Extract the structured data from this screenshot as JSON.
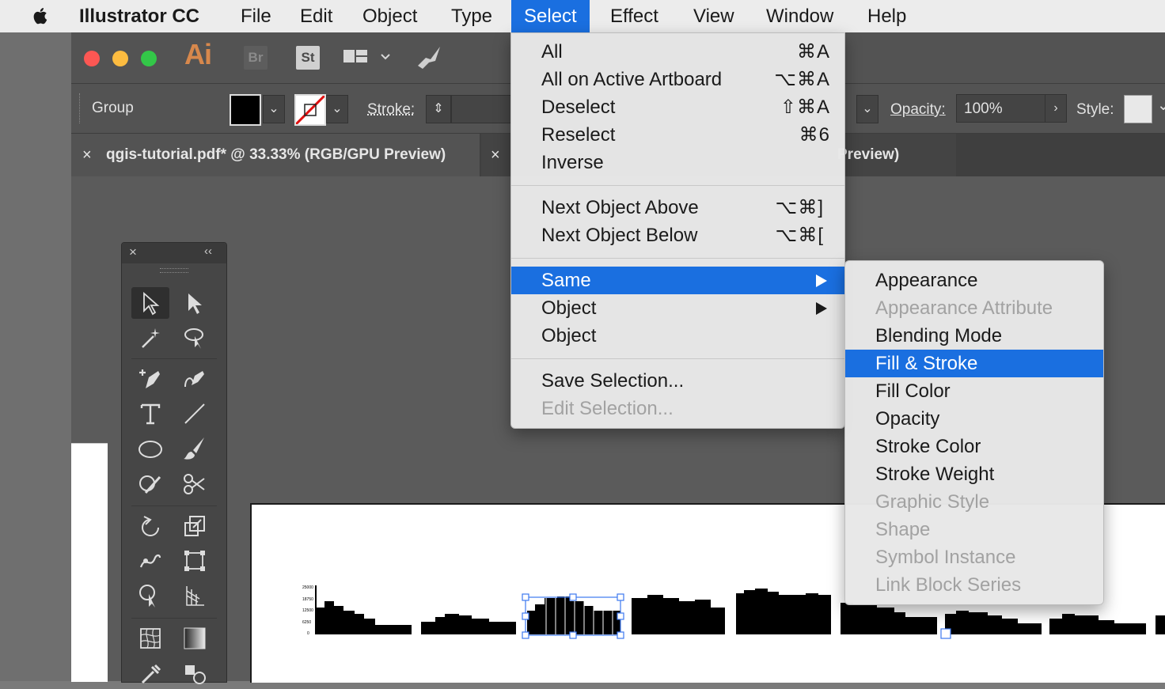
{
  "menubar": {
    "app_name": "Illustrator CC",
    "items": [
      "File",
      "Edit",
      "Object",
      "Type",
      "Select",
      "Effect",
      "View",
      "Window",
      "Help"
    ],
    "active": "Select"
  },
  "app": {
    "logo": "Ai",
    "bridge_label": "Br",
    "stock_label": "St",
    "traffic_colors": [
      "#fc5753",
      "#fdbc40",
      "#33c748"
    ]
  },
  "control_bar": {
    "selection_type": "Group",
    "stroke_label": "Stroke:",
    "opacity_label": "Opacity:",
    "opacity_value": "100%",
    "style_label": "Style:"
  },
  "tabs": [
    {
      "label": "qgis-tutorial.pdf* @ 33.33% (RGB/GPU Preview)"
    },
    {
      "label": "Preview)"
    }
  ],
  "select_menu": {
    "items": [
      {
        "label": "All",
        "shortcut": "⌘A",
        "state": "normal"
      },
      {
        "label": "All on Active Artboard",
        "shortcut": "⌥⌘A",
        "state": "normal"
      },
      {
        "label": "Deselect",
        "shortcut": "⇧⌘A",
        "state": "normal"
      },
      {
        "label": "Reselect",
        "shortcut": "⌘6",
        "state": "normal"
      },
      {
        "label": "Inverse",
        "shortcut": "",
        "state": "normal"
      },
      {
        "label": "Next Object Above",
        "shortcut": "⌥⌘]",
        "state": "normal"
      },
      {
        "label": "Next Object Below",
        "shortcut": "⌥⌘[",
        "state": "normal"
      },
      {
        "label": "Same",
        "shortcut": "",
        "state": "highlighted",
        "submenu": true
      },
      {
        "label": "Object",
        "shortcut": "",
        "state": "normal",
        "submenu": true
      },
      {
        "label": "Object",
        "shortcut": "",
        "state": "normal"
      },
      {
        "label": "Save Selection...",
        "shortcut": "",
        "state": "normal"
      },
      {
        "label": "Edit Selection...",
        "shortcut": "",
        "state": "disabled"
      }
    ]
  },
  "same_submenu": {
    "items": [
      {
        "label": "Appearance",
        "state": "normal"
      },
      {
        "label": "Appearance Attribute",
        "state": "disabled"
      },
      {
        "label": "Blending Mode",
        "state": "normal"
      },
      {
        "label": "Fill & Stroke",
        "state": "highlighted"
      },
      {
        "label": "Fill Color",
        "state": "normal"
      },
      {
        "label": "Opacity",
        "state": "normal"
      },
      {
        "label": "Stroke Color",
        "state": "normal"
      },
      {
        "label": "Stroke Weight",
        "state": "normal"
      },
      {
        "label": "Graphic Style",
        "state": "disabled"
      },
      {
        "label": "Shape",
        "state": "disabled"
      },
      {
        "label": "Symbol Instance",
        "state": "disabled"
      },
      {
        "label": "Link Block Series",
        "state": "disabled"
      }
    ]
  },
  "artwork": {
    "chart_labels": [
      "25000",
      "18750",
      "12500",
      "6250",
      "0"
    ]
  },
  "colors": {
    "menu_highlight": "#1a6fe0",
    "panel_dark": "#535353",
    "canvas": "#5b5b5b"
  }
}
